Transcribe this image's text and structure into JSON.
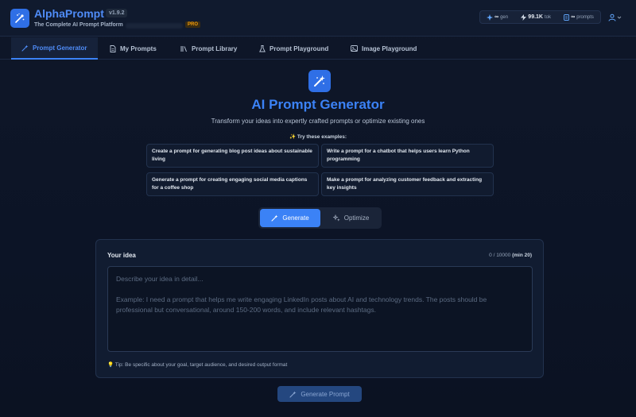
{
  "header": {
    "app_name": "AlphaPrompt",
    "version": "v1.9.2",
    "tagline": "The Complete AI Prompt Platform",
    "pro_badge": "PRO",
    "stats": [
      {
        "value": "∞",
        "label": "gen"
      },
      {
        "value": "99.1K",
        "label": "tok"
      },
      {
        "value": "∞",
        "label": "prompts"
      }
    ]
  },
  "tabs": [
    {
      "label": "Prompt Generator",
      "icon": "wand-icon",
      "active": true
    },
    {
      "label": "My Prompts",
      "icon": "document-icon",
      "active": false
    },
    {
      "label": "Prompt Library",
      "icon": "library-icon",
      "active": false
    },
    {
      "label": "Prompt Playground",
      "icon": "flask-icon",
      "active": false
    },
    {
      "label": "Image Playground",
      "icon": "image-icon",
      "active": false
    }
  ],
  "hero": {
    "title": "AI Prompt Generator",
    "subtitle": "Transform your ideas into expertly crafted prompts or optimize existing ones",
    "try_label": "✨ Try these examples:"
  },
  "examples": [
    "Create a prompt for generating blog post ideas about sustainable living",
    "Write a prompt for a chatbot that helps users learn Python programming",
    "Generate a prompt for creating engaging social media captions for a coffee shop",
    "Make a prompt for analyzing customer feedback and extracting key insights"
  ],
  "mode": {
    "generate_label": "Generate",
    "optimize_label": "Optimize"
  },
  "idea": {
    "label": "Your idea",
    "count": "0 / 10000",
    "min": "(min 20)",
    "placeholder": "Describe your idea in detail...\n\nExample: I need a prompt that helps me write engaging LinkedIn posts about AI and technology trends. The posts should be professional but conversational, around 150-200 words, and include relevant hashtags.",
    "tip": "💡 Tip: Be specific about your goal, target audience, and desired output format"
  },
  "generate_button": "Generate Prompt",
  "colors": {
    "accent": "#3b82f6",
    "background": "#0f1729",
    "pro": "#f59e0b"
  }
}
